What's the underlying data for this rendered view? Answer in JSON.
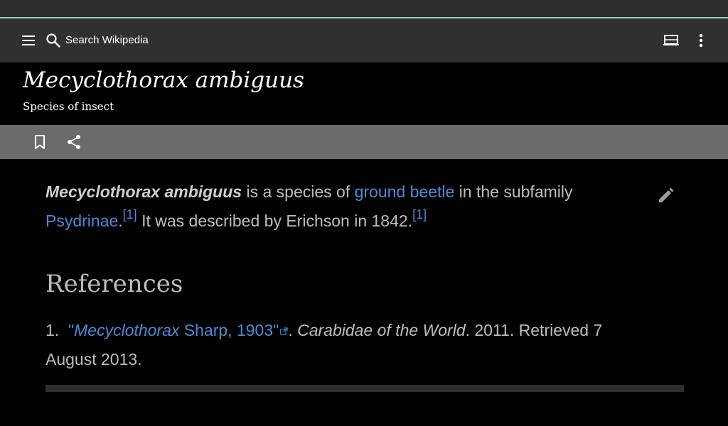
{
  "toolbar": {
    "search_placeholder": "Search Wikipedia",
    "icons": [
      "menu-icon",
      "search-icon",
      "tabs-icon",
      "more-vert-icon"
    ]
  },
  "article": {
    "title": "Mecyclothorax ambiguus",
    "description": "Species of insect",
    "lead": {
      "bold_name": "Mecyclothorax ambiguus",
      "text1": " is a species of ",
      "link1": "ground beetle",
      "text2": " in the subfamily ",
      "link2": "Psydrinae",
      "text3": ".",
      "cite1": "[1]",
      "text4": " It was described by Erichson in 1842.",
      "cite2": "[1]"
    }
  },
  "references": {
    "heading": "References",
    "items": [
      {
        "number": "1.",
        "link_open_quote": "\"",
        "link_italic": "Mecyclothorax",
        "link_rest": " Sharp, 1903\"",
        "after_link": ". ",
        "source_italic": "Carabidae of the World",
        "tail": ". 2011. Retrieved 7 August 2013."
      }
    ]
  },
  "colors": {
    "link": "#4b8ad6",
    "toolbar_bg": "#303030",
    "actionbar_bg": "#6b6b6b",
    "accent": "#8fcfc8"
  }
}
